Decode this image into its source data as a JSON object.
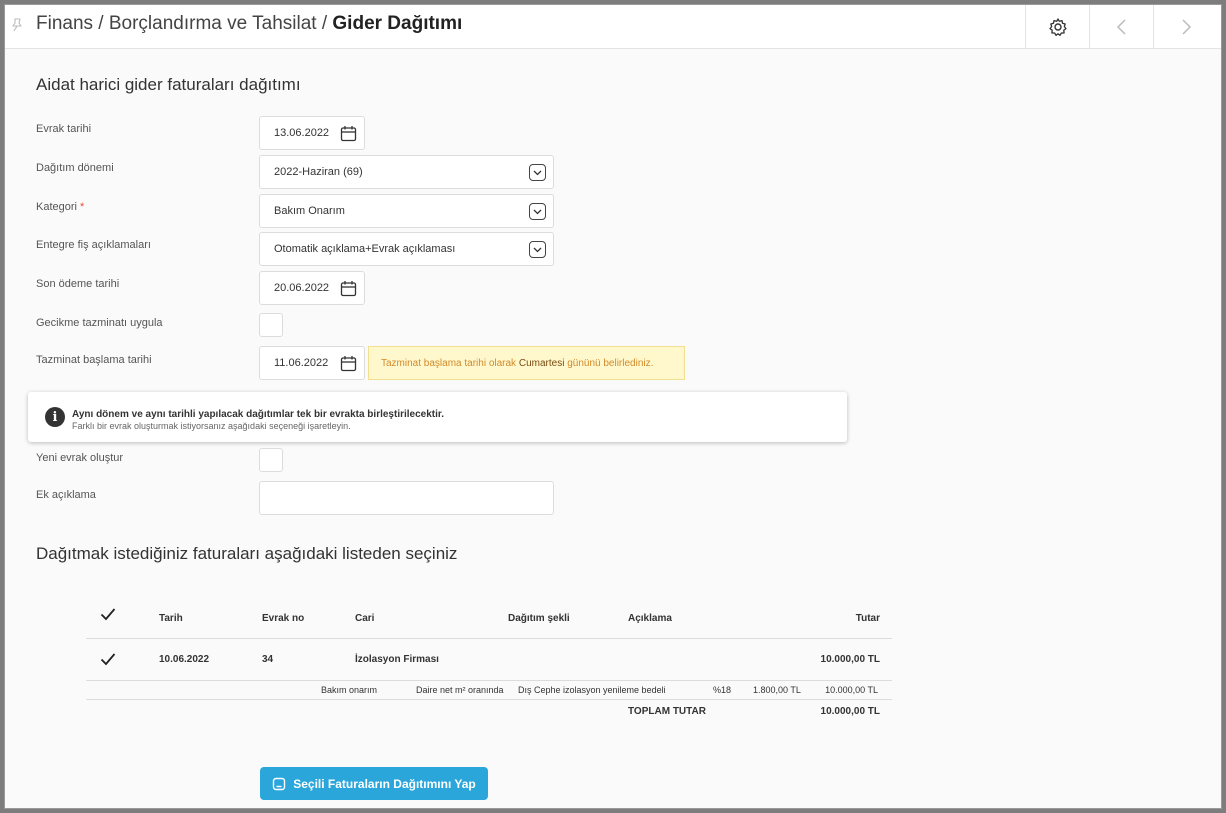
{
  "header": {
    "breadcrumb_prefix": "Finans / Borçlandırma ve Tahsilat / ",
    "breadcrumb_current": "Gider Dağıtımı",
    "icons": [
      "pin-icon",
      "gear-icon",
      "chevron-left-icon",
      "chevron-right-icon"
    ]
  },
  "form": {
    "title": "Aidat harici gider faturaları dağıtımı",
    "evrak_tarihi": {
      "label": "Evrak tarihi",
      "value": "13.06.2022"
    },
    "dagitim_donemi": {
      "label": "Dağıtım dönemi",
      "value": "2022-Haziran (69)"
    },
    "kategori": {
      "label": "Kategori",
      "required_mark": "*",
      "value": "Bakım Onarım"
    },
    "entegre": {
      "label": "Entegre fiş açıklamaları",
      "value": "Otomatik açıklama+Evrak açıklaması"
    },
    "son_odeme": {
      "label": "Son ödeme tarihi",
      "value": "20.06.2022"
    },
    "gecikme": {
      "label": "Gecikme tazminatı uygula"
    },
    "tazminat": {
      "label": "Tazminat başlama tarihi",
      "value": "11.06.2022",
      "warning_pre": "Tazminat başlama tarihi olarak ",
      "warning_day": "Cumartesi",
      "warning_post": " gününü belirlediniz."
    },
    "info": {
      "line1": "Aynı dönem ve aynı tarihli yapılacak dağıtımlar tek bir evrakta birleştirilecektir.",
      "line2": "Farklı bir evrak oluşturmak istiyorsanız aşağıdaki seçeneği işaretleyin."
    },
    "yeni_evrak": {
      "label": "Yeni evrak oluştur"
    },
    "ek_aciklama": {
      "label": "Ek açıklama",
      "value": ""
    }
  },
  "list": {
    "title": "Dağıtmak istediğiniz faturaları aşağıdaki listeden seçiniz",
    "columns": {
      "tarih": "Tarih",
      "evrak_no": "Evrak no",
      "cari": "Cari",
      "dagitim_sekli": "Dağıtım şekli",
      "aciklama": "Açıklama",
      "tutar": "Tutar"
    },
    "row": {
      "checked": true,
      "tarih": "10.06.2022",
      "evrak_no": "34",
      "cari": "İzolasyon Firması",
      "tutar": "10.000,00 TL"
    },
    "detail": {
      "kategori": "Bakım onarım",
      "dagitim": "Daire net m² oranında",
      "aciklama": "Dış Cephe izolasyon yenileme bedeli",
      "kdv": "%18",
      "kdv_tutar": "1.800,00 TL",
      "tutar": "10.000,00 TL"
    },
    "total_label": "TOPLAM TUTAR",
    "total_value": "10.000,00 TL"
  },
  "actions": {
    "submit_label": "Seçili Faturaların Dağıtımını Yap"
  },
  "colors": {
    "primary": "#2aa6db",
    "warning_bg": "#fff8cc",
    "warning_text": "#d38a2a"
  }
}
